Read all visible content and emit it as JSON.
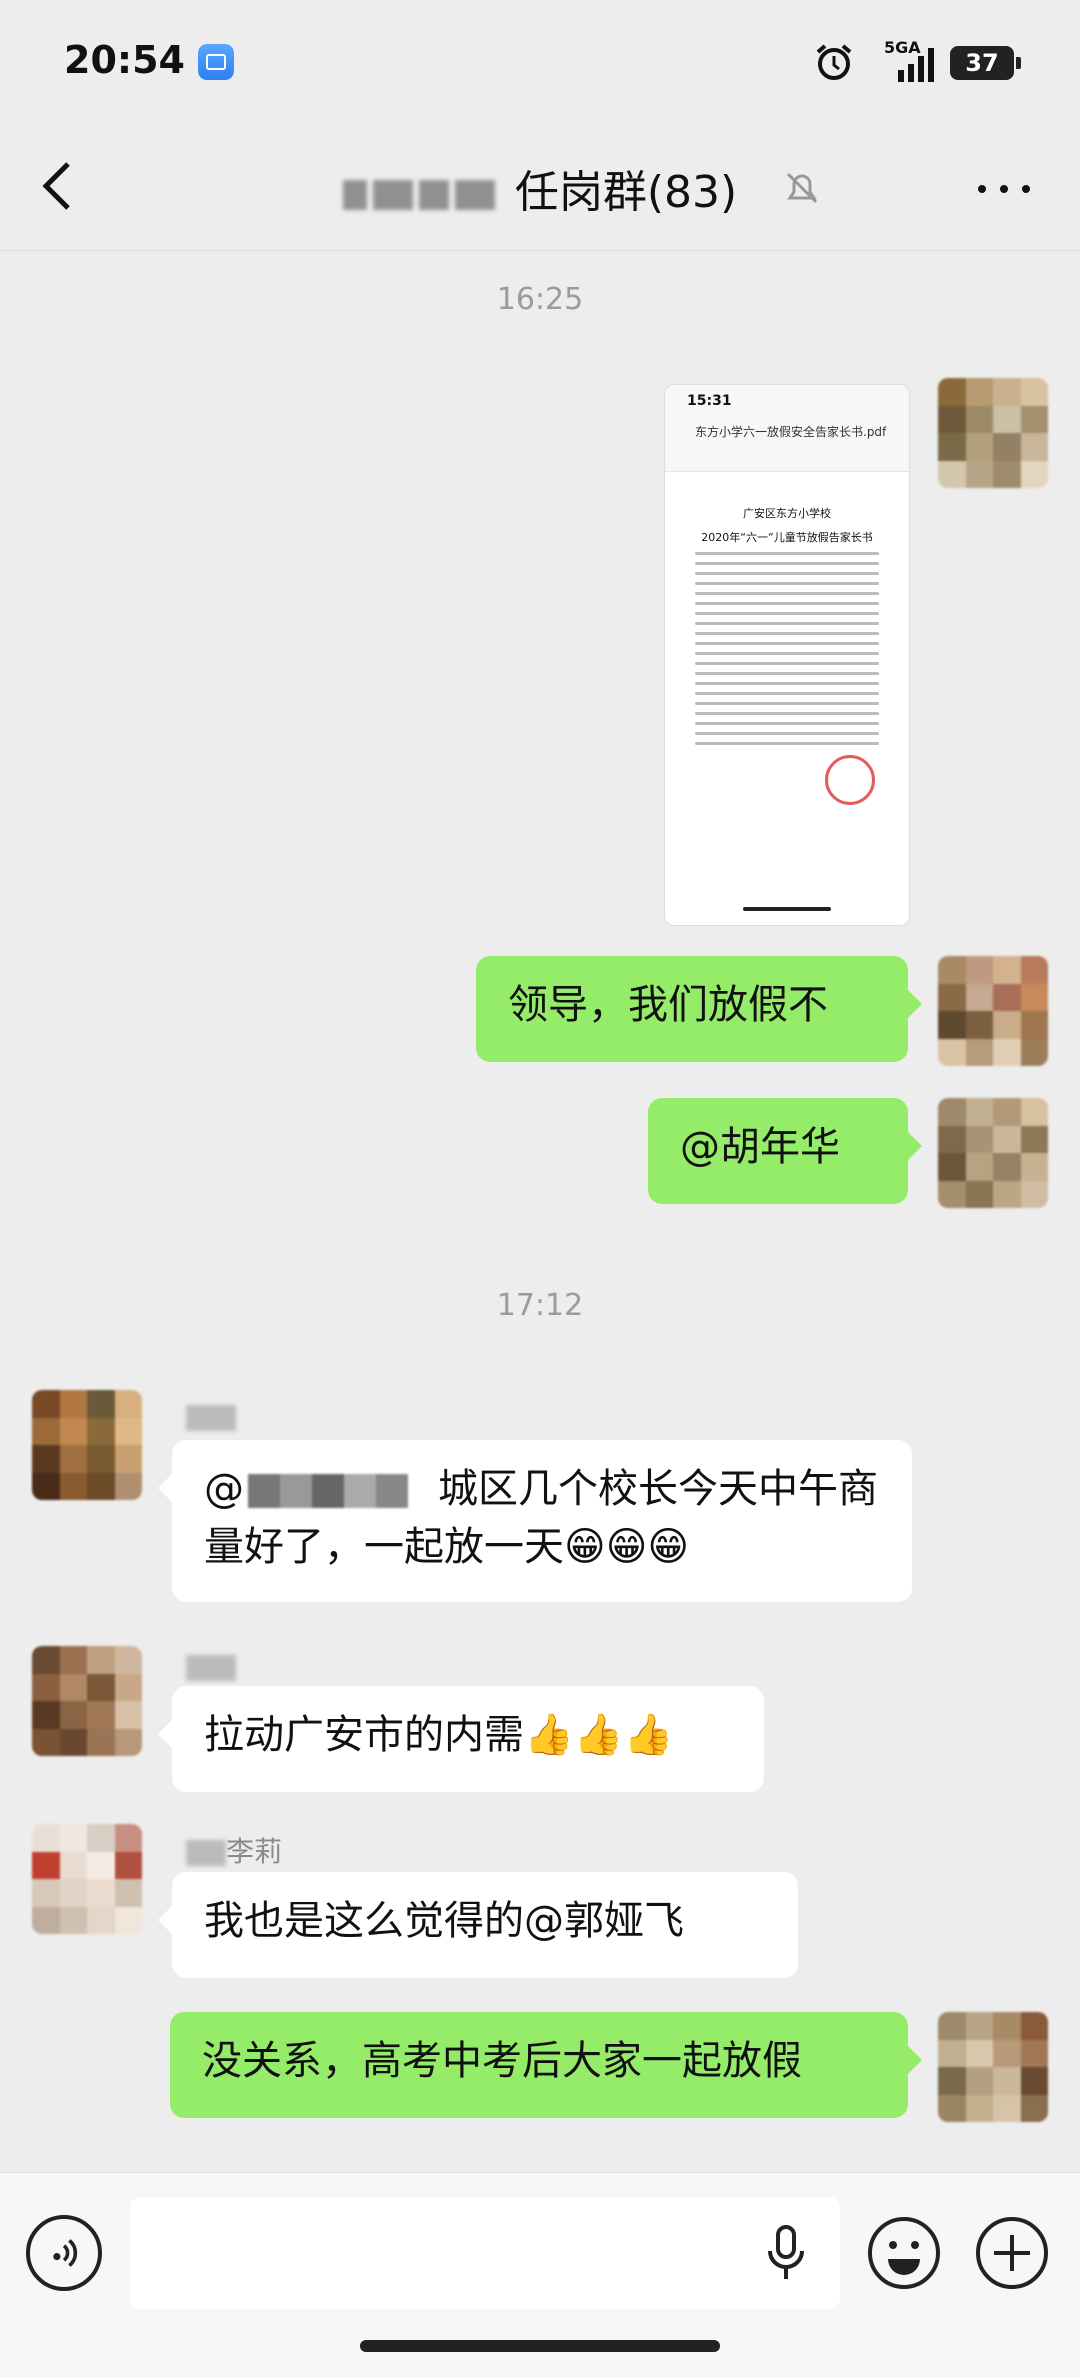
{
  "status": {
    "time": "20:54",
    "network": "5GA",
    "battery": "37"
  },
  "header": {
    "title": "任岗群(83)"
  },
  "timestamps": [
    "16:25",
    "17:12"
  ],
  "file": {
    "phone_time": "15:31",
    "filename": "东方小学六一放假安全告家长书.pdf",
    "doc_org": "广安区东方小学校",
    "doc_title": "2020年“六一”儿童节放假告家长书"
  },
  "messages": [
    {
      "text": "领导，我们放假不"
    },
    {
      "text": "@胡年华"
    },
    {
      "text": "城区几个校长今天中午商量好了，一起放一天😁😁😁"
    },
    {
      "text": "拉动广安市的内需👍👍👍"
    },
    {
      "sender": "李莉",
      "text": "我也是这么觉得的@郭娅飞"
    },
    {
      "text": "没关系，高考中考后大家一起放假"
    }
  ],
  "composer": {
    "placeholder": ""
  },
  "colors": {
    "bubble_green": "#95ec69",
    "background": "#ededed"
  },
  "icons": [
    "back-icon",
    "mute-icon",
    "more-icon",
    "voice-icon",
    "mic-icon",
    "emoji-icon",
    "plus-icon",
    "alarm-icon",
    "signal-icon"
  ]
}
